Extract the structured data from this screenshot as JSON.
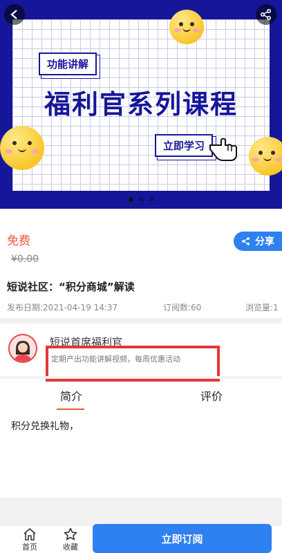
{
  "banner": {
    "tag_top": "功能讲解",
    "title": "福利官系列课程",
    "tag_learn": "立即学习",
    "active_slide": 1,
    "slide_count": 3
  },
  "course": {
    "price": "免费",
    "original_price": "¥0.00",
    "title": "短说社区：“积分商城”解读",
    "date": "发布日期:2021-04-19 14:37",
    "subscriptions": "订阅数:60",
    "views": "浏览量:1",
    "share_label": "分享"
  },
  "author": {
    "name": "短说首席福利官",
    "description": "定期产出功能讲解视频，每周优惠活动"
  },
  "tabs": {
    "intro": "简介",
    "review": "评价",
    "active": "intro"
  },
  "content": {
    "text": "积分兑换礼物，"
  },
  "bottom_nav": {
    "home": "首页",
    "favorite": "收藏",
    "subscribe": "立即订阅"
  },
  "colors": {
    "banner_bg": "#16169a",
    "accent_blue": "#2f80f0",
    "price_red": "#f0573a",
    "highlight_red": "#e3383a"
  }
}
